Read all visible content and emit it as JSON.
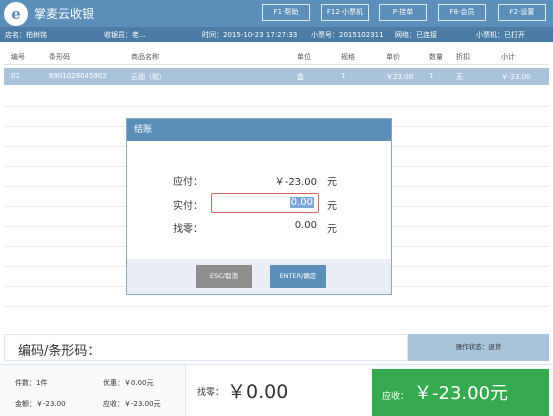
{
  "app": {
    "title": "掌麦云收银",
    "logo_icon": "logo-icon"
  },
  "function_keys": [
    {
      "label": "F1·帮助"
    },
    {
      "label": "F12·小票机"
    },
    {
      "label": "P·挂单"
    },
    {
      "label": "F8·会员"
    },
    {
      "label": "F2·设置"
    }
  ],
  "info_bar": {
    "store": "店名：柏树铭",
    "cashier": "收银员：老...",
    "time": "时间：2015-10-23 17:27:33",
    "receipt_no": "小票号：2015102311",
    "network": "网络：已连接",
    "printer": "小票机：已打开"
  },
  "table": {
    "headers": [
      "编号",
      "条形码",
      "商品名称",
      "单位",
      "规格",
      "单价",
      "数量",
      "折扣",
      "小计"
    ],
    "rows": [
      [
        "01",
        "6901028045902",
        "云烟（软）",
        "盒",
        "1",
        "￥23.00",
        "1",
        "无",
        "￥-23.00"
      ]
    ]
  },
  "checkout_modal": {
    "title": "结账",
    "payable_label": "应付：",
    "payable_value": "￥-23.00",
    "payable_unit": "元",
    "paid_label": "实付：",
    "paid_value": "0.00",
    "paid_unit": "元",
    "change_label": "找零：",
    "change_value": "0.00",
    "change_unit": "元",
    "cancel_label": "ESC/取消",
    "confirm_label": "ENTER/确定"
  },
  "scan": {
    "label": "编码/条形码：",
    "status": "操作状态：退货"
  },
  "summary": {
    "items": "件数：1件",
    "discount": "优惠：￥0.00元",
    "amount": "金额：￥-23.00",
    "receivable_small": "应收：￥-23.00元",
    "change_label": "找零：",
    "change_value": "￥0.00",
    "receivable_label": "应收：",
    "receivable_value": "￥-23.00元"
  },
  "colors": {
    "header": "#5b8fb9",
    "info_bar": "#4a7ca5",
    "selected_row": "#a9c3da",
    "receivable": "#35aa4f",
    "input_border": "#d96565"
  }
}
